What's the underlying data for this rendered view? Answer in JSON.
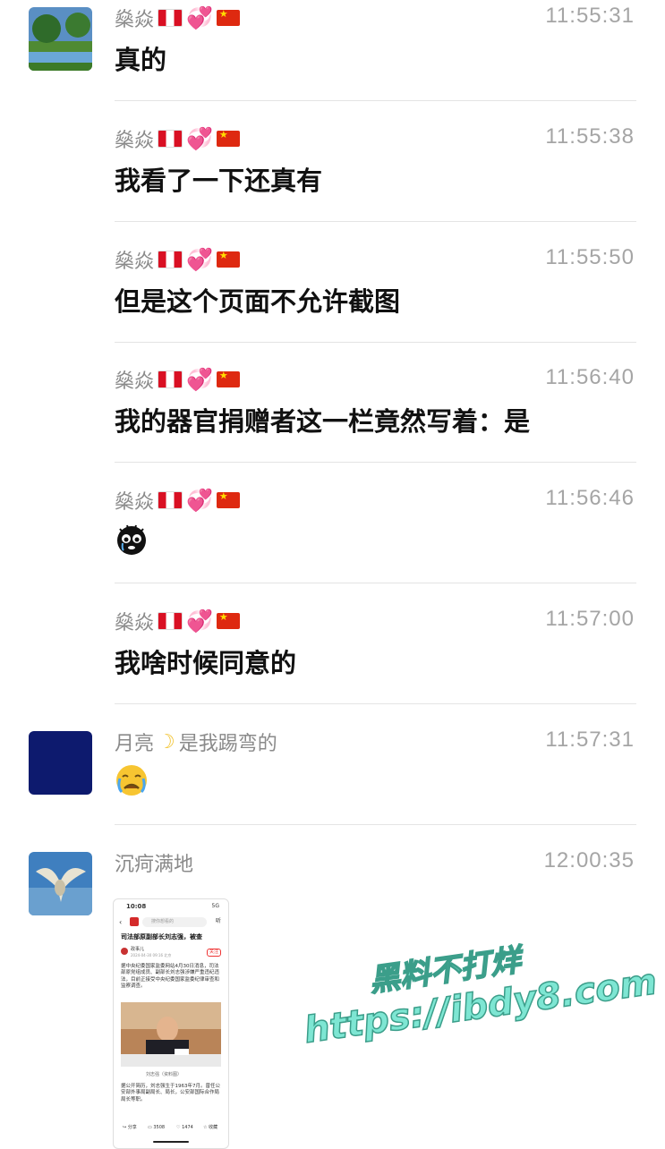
{
  "messages": [
    {
      "sender": "燊焱",
      "time": "11:55:31",
      "text": "真的"
    },
    {
      "sender": "燊焱",
      "time": "11:55:38",
      "text": "我看了一下还真有"
    },
    {
      "sender": "燊焱",
      "time": "11:55:50",
      "text": "但是这个页面不允许截图"
    },
    {
      "sender": "燊焱",
      "time": "11:56:40",
      "text": "我的器官捐赠者这一栏竟然写着：是"
    },
    {
      "sender": "燊焱",
      "time": "11:56:46",
      "emoji": "crying-cat-face-sticker"
    },
    {
      "sender": "燊焱",
      "time": "11:57:00",
      "text": "我啥时候同意的"
    },
    {
      "sender_prefix": "月亮",
      "sender_suffix": "是我踢弯的",
      "time": "11:57:31",
      "emoji": "crying-face-emoji"
    },
    {
      "sender": "沉疴满地",
      "time": "12:00:35"
    }
  ],
  "card": {
    "status_time": "10:08",
    "status_signal": "5G",
    "search_placeholder": "搜你想看的",
    "headline": "司法部原副部长刘志强，被查",
    "source": "政事儿",
    "follow": "关注",
    "meta": "2024-04-30 09:16 北京",
    "body": "据中央纪委国家监委网站4月30日消息，司法部原党组成员、副部长刘志强涉嫌严重违纪违法，目前正接受中央纪委国家监委纪律审查和监察调查。",
    "caption": "刘志强（资料图）",
    "body2": "据公开简历，刘志强生于1963年7月。曾任公安部外事局副局长、局长，公安部国际合作局局长等职。",
    "share": "分享",
    "comments": "3508",
    "likes": "1474",
    "collect": "收藏",
    "listen": "听"
  },
  "watermark": {
    "line1": "黑料不打烊",
    "line2": "https://ibdy8.com"
  },
  "colors": {
    "accent_pink": "#f05aa7",
    "watermark": "#7ee6d3",
    "name_gray": "#8a8a8a"
  }
}
